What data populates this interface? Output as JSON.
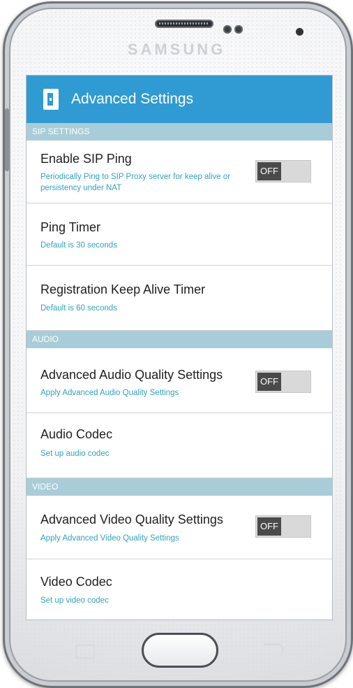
{
  "device": {
    "brand": "SAMSUNG"
  },
  "appbar": {
    "title": "Advanced Settings",
    "icon": "app-door-icon"
  },
  "sections": {
    "sip": "SIP SETTINGS",
    "audio": "AUDIO",
    "video": "VIDEO"
  },
  "sip_items": {
    "enable_ping": {
      "title": "Enable SIP Ping",
      "subtitle": "Periodically Ping to SIP Proxy server for keep alive or persistency under NAT",
      "toggle": "OFF"
    },
    "ping_timer": {
      "title": "Ping Timer",
      "subtitle": "Default is 30 seconds"
    },
    "keep_alive": {
      "title": "Registration Keep Alive Timer",
      "subtitle": "Default is 60 seconds"
    }
  },
  "audio_items": {
    "quality": {
      "title": "Advanced Audio Quality Settings",
      "subtitle": "Apply Advanced Audio Quality Settings",
      "toggle": "OFF"
    },
    "codec": {
      "title": "Audio Codec",
      "subtitle": "Set up audio codec"
    }
  },
  "video_items": {
    "quality": {
      "title": "Advanced Video Quality Settings",
      "subtitle": "Apply Advanced Video Quality Settings",
      "toggle": "OFF"
    },
    "codec": {
      "title": "Video Codec",
      "subtitle": "Set up video codec"
    }
  },
  "colors": {
    "accent": "#2f9bd2",
    "section": "#a9cdd8",
    "subtitle": "#2fa3bd"
  }
}
